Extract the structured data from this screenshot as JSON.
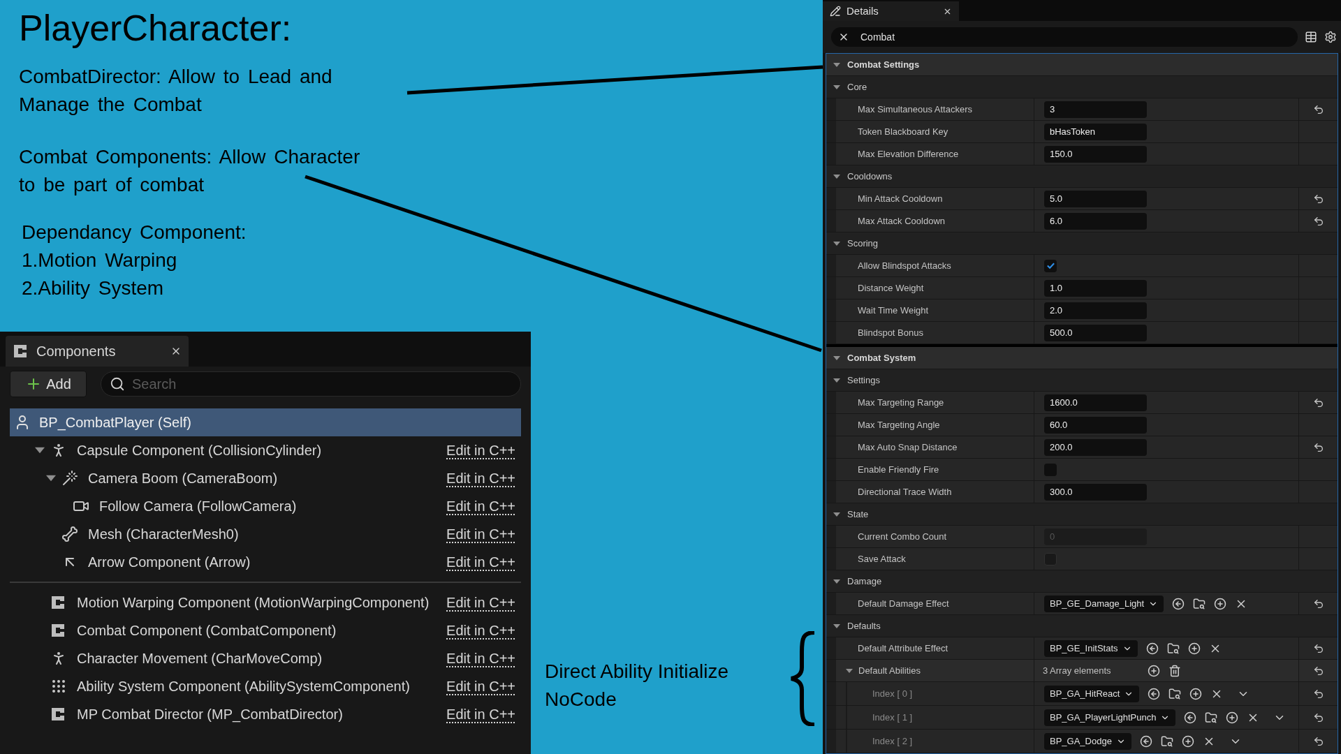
{
  "annotations": {
    "title": "PlayerCharacter:",
    "notes": [
      "CombatDirector: Allow to Lead and Manage the Combat",
      "Combat Components: Allow Character to be part of combat"
    ],
    "dependency": {
      "heading": "Dependancy Component:",
      "items": [
        "1.Motion Warping",
        "2.Ability System"
      ]
    },
    "side_note": "Direct Ability Initialize NoCode"
  },
  "components_panel": {
    "tab": {
      "title": "Components"
    },
    "add_button": {
      "label": "Add"
    },
    "search": {
      "placeholder": "Search"
    },
    "root": {
      "label": "BP_CombatPlayer (Self)",
      "selected": true
    },
    "scene_components": [
      {
        "kind": "capsule",
        "label": "Capsule Component (CollisionCylinder)",
        "link": "Edit in C++",
        "selected": false,
        "expanded": true,
        "children": [
          {
            "kind": "boom",
            "label": "Camera Boom (CameraBoom)",
            "link": "Edit in C++",
            "selected": false,
            "expanded": true,
            "children": [
              {
                "kind": "camera",
                "label": "Follow Camera (FollowCamera)",
                "link": "Edit in C++",
                "selected": false
              }
            ]
          },
          {
            "kind": "mesh",
            "label": "Mesh (CharacterMesh0)",
            "link": "Edit in C++",
            "selected": false
          },
          {
            "kind": "arrow",
            "label": "Arrow Component (Arrow)",
            "link": "Edit in C++",
            "selected": false
          }
        ]
      }
    ],
    "other_components": [
      {
        "kind": "component",
        "label": "Motion Warping Component (MotionWarpingComponent)",
        "link": "Edit in C++",
        "selected": false
      },
      {
        "kind": "component",
        "label": "Combat Component (CombatComponent)",
        "link": "Edit in C++",
        "selected": false
      },
      {
        "kind": "movement",
        "label": "Character Movement (CharMoveComp)",
        "link": "Edit in C++",
        "selected": false
      },
      {
        "kind": "ability",
        "label": "Ability System Component (AbilitySystemComponent)",
        "link": "Edit in C++",
        "selected": false
      },
      {
        "kind": "component",
        "label": "MP Combat Director (MP_CombatDirector)",
        "link": "Edit in C++",
        "selected": false
      }
    ]
  },
  "details_panel": {
    "tab": {
      "title": "Details"
    },
    "search": {
      "value": "Combat"
    },
    "sections": [
      {
        "title": "Combat Settings",
        "expanded": true,
        "groups": [
          {
            "title": "Core",
            "expanded": true,
            "properties": [
              {
                "label": "Max Simultaneous Attackers",
                "kind": "field",
                "value": "3",
                "disabled": false,
                "reset": true
              },
              {
                "label": "Token Blackboard Key",
                "kind": "field",
                "value": "bHasToken",
                "disabled": false,
                "reset": false
              },
              {
                "label": "Max Elevation Difference",
                "kind": "field",
                "value": "150.0",
                "disabled": false,
                "reset": false
              }
            ]
          },
          {
            "title": "Cooldowns",
            "expanded": true,
            "properties": [
              {
                "label": "Min Attack Cooldown",
                "kind": "field",
                "value": "5.0",
                "disabled": false,
                "reset": true
              },
              {
                "label": "Max Attack Cooldown",
                "kind": "field",
                "value": "6.0",
                "disabled": false,
                "reset": true
              }
            ]
          },
          {
            "title": "Scoring",
            "expanded": true,
            "properties": [
              {
                "label": "Allow Blindspot Attacks",
                "kind": "checkbox",
                "checked": true,
                "disabled": false,
                "reset": false
              },
              {
                "label": "Distance Weight",
                "kind": "field",
                "value": "1.0",
                "disabled": false,
                "reset": false
              },
              {
                "label": "Wait Time Weight",
                "kind": "field",
                "value": "2.0",
                "disabled": false,
                "reset": false
              },
              {
                "label": "Blindspot Bonus",
                "kind": "field",
                "value": "500.0",
                "disabled": false,
                "reset": false
              }
            ]
          }
        ]
      },
      {
        "title": "Combat System",
        "expanded": true,
        "groups": [
          {
            "title": "Settings",
            "expanded": true,
            "properties": [
              {
                "label": "Max Targeting Range",
                "kind": "field",
                "value": "1600.0",
                "disabled": false,
                "reset": true
              },
              {
                "label": "Max Targeting Angle",
                "kind": "field",
                "value": "60.0",
                "disabled": false,
                "reset": false
              },
              {
                "label": "Max Auto Snap Distance",
                "kind": "field",
                "value": "200.0",
                "disabled": false,
                "reset": true
              },
              {
                "label": "Enable Friendly Fire",
                "kind": "checkbox",
                "checked": false,
                "disabled": false,
                "reset": false
              },
              {
                "label": "Directional Trace Width",
                "kind": "field",
                "value": "300.0",
                "disabled": false,
                "reset": false
              }
            ]
          },
          {
            "title": "State",
            "expanded": true,
            "properties": [
              {
                "label": "Current Combo Count",
                "kind": "field",
                "value": "0",
                "disabled": true,
                "reset": false
              },
              {
                "label": "Save Attack",
                "kind": "checkbox",
                "checked": false,
                "disabled": true,
                "reset": false
              }
            ]
          },
          {
            "title": "Damage",
            "expanded": true,
            "properties": [
              {
                "label": "Default Damage Effect",
                "kind": "asset",
                "value": "BP_GE_Damage_Light",
                "disabled": false,
                "reset": true
              }
            ]
          },
          {
            "title": "Defaults",
            "expanded": true,
            "properties": [
              {
                "label": "Default Attribute Effect",
                "kind": "asset",
                "value": "BP_GE_InitStats",
                "disabled": false,
                "reset": true
              },
              {
                "label": "Default Abilities",
                "kind": "array",
                "value": "3 Array elements",
                "disabled": false,
                "reset": true,
                "expanded": true,
                "elements": [
                  {
                    "label": "Index [ 0 ]",
                    "value": "BP_GA_HitReact",
                    "reset": true
                  },
                  {
                    "label": "Index [ 1 ]",
                    "value": "BP_GA_PlayerLightPunch",
                    "reset": true
                  },
                  {
                    "label": "Index [ 2 ]",
                    "value": "BP_GA_Dodge",
                    "reset": true
                  }
                ]
              }
            ]
          }
        ]
      }
    ]
  }
}
